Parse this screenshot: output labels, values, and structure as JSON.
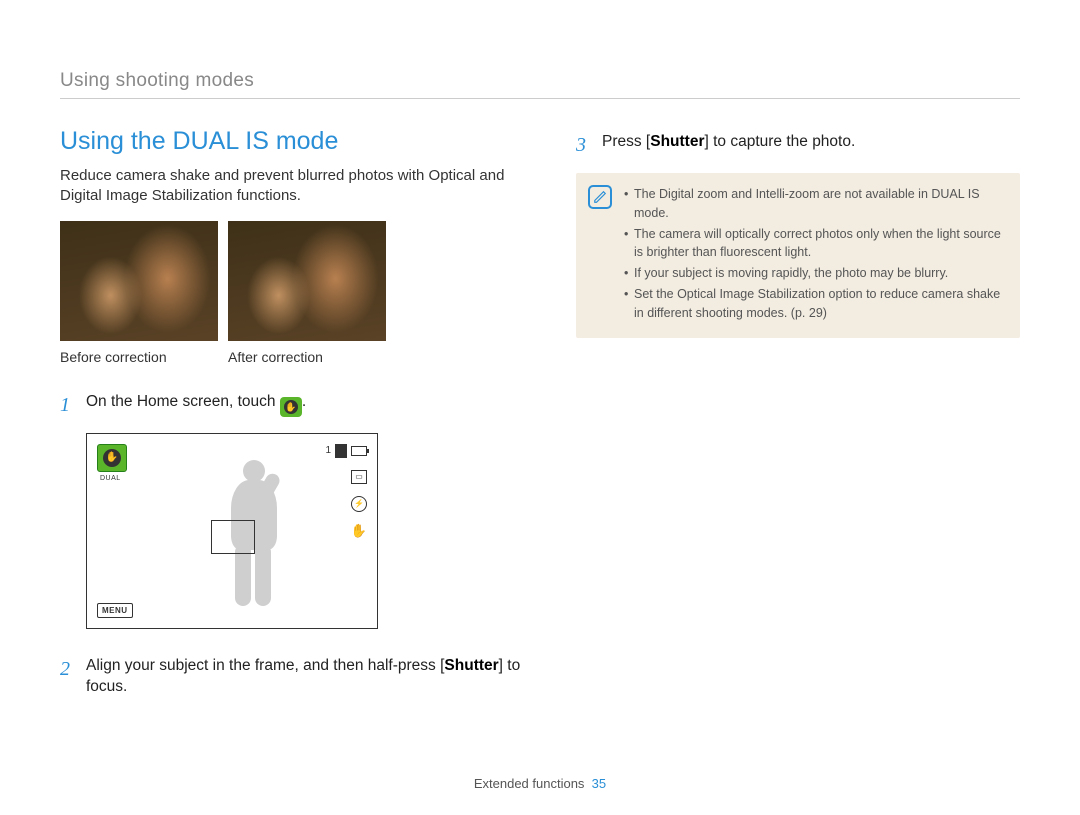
{
  "breadcrumb": "Using shooting modes",
  "title": "Using the DUAL IS mode",
  "intro": "Reduce camera shake and prevent blurred photos with Optical and Digital Image Stabilization functions.",
  "captions": {
    "before": "Before correction",
    "after": "After correction"
  },
  "steps": {
    "s1_before": "On the Home screen, touch ",
    "s1_after": ".",
    "s2_a": "Align your subject in the frame, and then half-press [",
    "s2_b": "Shutter",
    "s2_c": "] to focus.",
    "s3_a": "Press [",
    "s3_b": "Shutter",
    "s3_c": "] to capture the photo.",
    "n1": "1",
    "n2": "2",
    "n3": "3"
  },
  "lcd": {
    "dual_label": "DUAL",
    "remaining": "1",
    "menu": "MENU"
  },
  "notes": {
    "n1": "The Digital zoom and Intelli-zoom are not available in DUAL IS mode.",
    "n2": "The camera will optically correct photos only when the light source is brighter than fluorescent light.",
    "n3": "If your subject is moving rapidly, the photo may be blurry.",
    "n4": "Set the Optical Image Stabilization option to reduce camera shake in different shooting modes. (p. 29)"
  },
  "footer": {
    "section": "Extended functions",
    "page": "35"
  }
}
